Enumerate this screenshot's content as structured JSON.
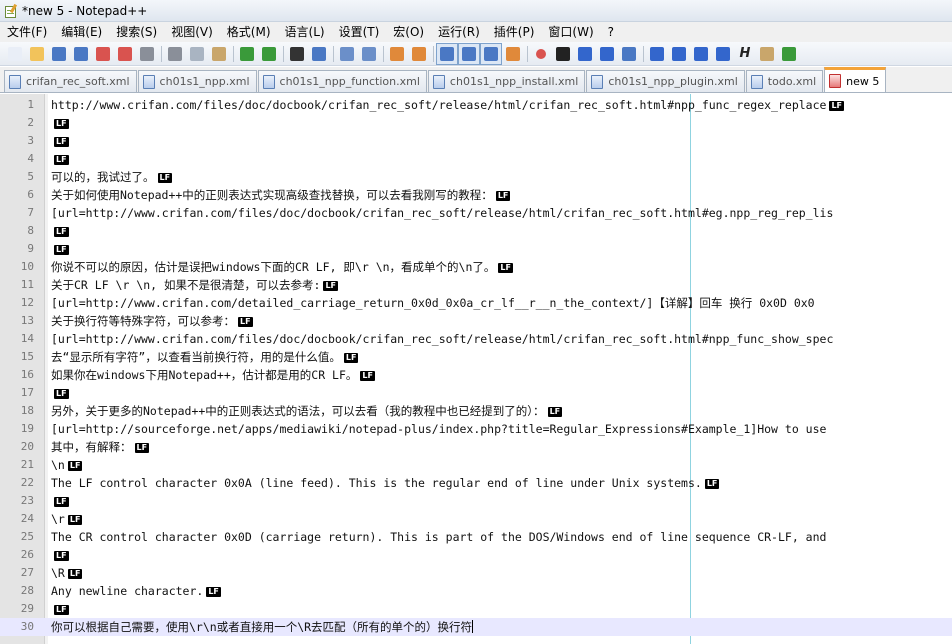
{
  "window": {
    "title": "*new  5 - Notepad++"
  },
  "menu": [
    "文件(F)",
    "编辑(E)",
    "搜索(S)",
    "视图(V)",
    "格式(M)",
    "语言(L)",
    "设置(T)",
    "宏(O)",
    "运行(R)",
    "插件(P)",
    "窗口(W)",
    "?"
  ],
  "toolbar": [
    {
      "name": "new-file-icon",
      "color": "#e9eef7"
    },
    {
      "name": "open-file-icon",
      "color": "#f2c35b"
    },
    {
      "name": "save-icon",
      "color": "#4a78c4"
    },
    {
      "name": "save-all-icon",
      "color": "#4a78c4"
    },
    {
      "name": "close-icon",
      "color": "#d9534f"
    },
    {
      "name": "close-all-icon",
      "color": "#d9534f"
    },
    {
      "name": "print-icon",
      "color": "#8a8f99"
    },
    {
      "name": "sep"
    },
    {
      "name": "cut-icon",
      "color": "#8a8f99"
    },
    {
      "name": "copy-icon",
      "color": "#a9b4c2"
    },
    {
      "name": "paste-icon",
      "color": "#c9a66b"
    },
    {
      "name": "sep"
    },
    {
      "name": "undo-icon",
      "color": "#3a9a3a"
    },
    {
      "name": "redo-icon",
      "color": "#3a9a3a"
    },
    {
      "name": "sep"
    },
    {
      "name": "find-icon",
      "color": "#333333"
    },
    {
      "name": "replace-icon",
      "color": "#4a78c4"
    },
    {
      "name": "sep"
    },
    {
      "name": "zoom-in-icon",
      "color": "#6b8fc9"
    },
    {
      "name": "zoom-out-icon",
      "color": "#6b8fc9"
    },
    {
      "name": "sep"
    },
    {
      "name": "sync-vertical-icon",
      "color": "#e0893a"
    },
    {
      "name": "sync-horizontal-icon",
      "color": "#e0893a"
    },
    {
      "name": "sep"
    },
    {
      "name": "word-wrap-icon",
      "color": "#4a78c4",
      "pressed": true
    },
    {
      "name": "show-all-chars-icon",
      "color": "#4a78c4",
      "pressed": true
    },
    {
      "name": "indent-guide-icon",
      "color": "#4a78c4",
      "pressed": true
    },
    {
      "name": "user-lang-icon",
      "color": "#e0893a"
    },
    {
      "name": "sep"
    },
    {
      "name": "record-macro-icon",
      "color": "#d9534f"
    },
    {
      "name": "stop-macro-icon",
      "color": "#222222"
    },
    {
      "name": "play-macro-icon",
      "color": "#3366cc"
    },
    {
      "name": "play-multiple-macro-icon",
      "color": "#3366cc"
    },
    {
      "name": "save-macro-icon",
      "color": "#4a78c4"
    },
    {
      "name": "sep"
    },
    {
      "name": "hide-lines-icon",
      "color": "#3366cc"
    },
    {
      "name": "move-up-icon",
      "color": "#3366cc"
    },
    {
      "name": "move-down-icon",
      "color": "#3366cc"
    },
    {
      "name": "sort-icon",
      "color": "#3366cc"
    },
    {
      "name": "h-icon",
      "color": "#222222"
    },
    {
      "name": "doc-map-icon",
      "color": "#c9a66b"
    },
    {
      "name": "spell-check-icon",
      "color": "#3a9a3a"
    }
  ],
  "tabs": [
    {
      "label": "crifan_rec_soft.xml",
      "active": false
    },
    {
      "label": "ch01s1_npp.xml",
      "active": false
    },
    {
      "label": "ch01s1_npp_function.xml",
      "active": false
    },
    {
      "label": "ch01s1_npp_install.xml",
      "active": false
    },
    {
      "label": "ch01s1_npp_plugin.xml",
      "active": false
    },
    {
      "label": "todo.xml",
      "active": false
    },
    {
      "label": "new  5",
      "active": true
    }
  ],
  "editor": {
    "eol_marker": "LF",
    "current_line": 30,
    "lines": [
      {
        "n": 1,
        "text": "http://www.crifan.com/files/doc/docbook/crifan_rec_soft/release/html/crifan_rec_soft.html#npp_func_regex_replace",
        "lf": true
      },
      {
        "n": 2,
        "text": "",
        "lf": true
      },
      {
        "n": 3,
        "text": "",
        "lf": true
      },
      {
        "n": 4,
        "text": "",
        "lf": true
      },
      {
        "n": 5,
        "text": "可以的，我试过了。",
        "lf": true
      },
      {
        "n": 6,
        "text": "关于如何使用Notepad++中的正则表达式实现高级查找替换，可以去看我刚写的教程：",
        "lf": true
      },
      {
        "n": 7,
        "text": "[url=http://www.crifan.com/files/doc/docbook/crifan_rec_soft/release/html/crifan_rec_soft.html#eg.npp_reg_rep_lis",
        "lf": false
      },
      {
        "n": 8,
        "text": "",
        "lf": true
      },
      {
        "n": 9,
        "text": "",
        "lf": true
      },
      {
        "n": 10,
        "text": "你说不可以的原因，估计是误把windows下面的CR LF, 即\\r \\n，看成单个的\\n了。",
        "lf": true
      },
      {
        "n": 11,
        "text": "关于CR LF \\r \\n, 如果不是很清楚，可以去参考:",
        "lf": true
      },
      {
        "n": 12,
        "text": "[url=http://www.crifan.com/detailed_carriage_return_0x0d_0x0a_cr_lf__r__n_the_context/]【详解】回车 换行 0x0D 0x0",
        "lf": false
      },
      {
        "n": 13,
        "text": "关于换行符等特殊字符，可以参考：",
        "lf": true
      },
      {
        "n": 14,
        "text": "[url=http://www.crifan.com/files/doc/docbook/crifan_rec_soft/release/html/crifan_rec_soft.html#npp_func_show_spec",
        "lf": false
      },
      {
        "n": 15,
        "text": "去“显示所有字符”，以查看当前换行符，用的是什么值。",
        "lf": true
      },
      {
        "n": 16,
        "text": "如果你在windows下用Notepad++，估计都是用的CR LF。",
        "lf": true
      },
      {
        "n": 17,
        "text": "",
        "lf": true
      },
      {
        "n": 18,
        "text": "另外，关于更多的Notepad++中的正则表达式的语法，可以去看（我的教程中也已经提到了的）：",
        "lf": true
      },
      {
        "n": 19,
        "text": "[url=http://sourceforge.net/apps/mediawiki/notepad-plus/index.php?title=Regular_Expressions#Example_1]How to use",
        "lf": false
      },
      {
        "n": 20,
        "text": "其中，有解释：",
        "lf": true
      },
      {
        "n": 21,
        "text": "\\n",
        "lf": true
      },
      {
        "n": 22,
        "text": "The LF control character 0x0A (line feed). This is the regular end of line under Unix systems.",
        "lf": true
      },
      {
        "n": 23,
        "text": "",
        "lf": true
      },
      {
        "n": 24,
        "text": "\\r",
        "lf": true
      },
      {
        "n": 25,
        "text": "The CR control character 0x0D (carriage return). This is part of the DOS/Windows end of line sequence CR-LF, and",
        "lf": false
      },
      {
        "n": 26,
        "text": "",
        "lf": true
      },
      {
        "n": 27,
        "text": "\\R",
        "lf": true
      },
      {
        "n": 28,
        "text": "Any newline character.",
        "lf": true
      },
      {
        "n": 29,
        "text": "",
        "lf": true
      },
      {
        "n": 30,
        "text": "你可以根据自己需要，使用\\r\\n或者直接用一个\\R去匹配（所有的单个的）换行符",
        "lf": false,
        "caret": true
      }
    ]
  }
}
